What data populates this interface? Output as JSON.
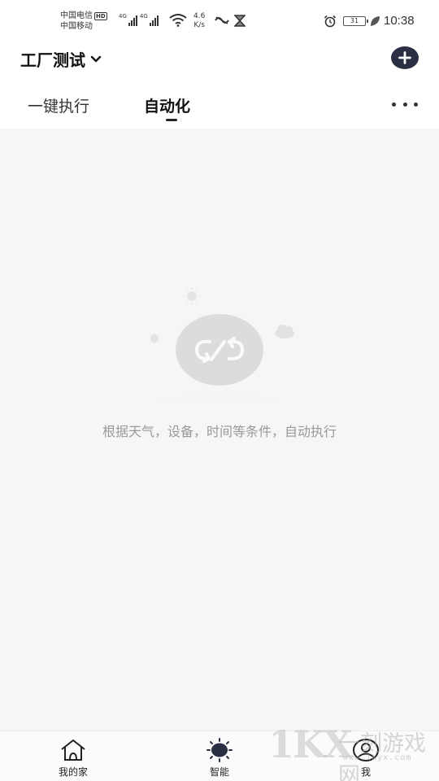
{
  "status_bar": {
    "carrier_1": "中国电信",
    "carrier_1_badge": "HD",
    "carrier_2": "中国移动",
    "signal_1_tag": "4G",
    "signal_2_tag": "4G",
    "net_speed_value": "4.6",
    "net_speed_unit": "K/s",
    "battery_level": "31",
    "time": "10:38"
  },
  "header": {
    "home_name": "工厂测试",
    "selector_icon": "chevron-down-icon",
    "add_icon": "plus-icon",
    "add_button_color": "#2b2f44"
  },
  "tabs": [
    {
      "label": "一键执行",
      "active": false
    },
    {
      "label": "自动化",
      "active": true
    }
  ],
  "more_icon": "more-horizontal-icon",
  "empty_state": {
    "icon": "automation-loop-icon",
    "message": "根据天气，设备，时间等条件，自动执行"
  },
  "bottom_nav": [
    {
      "label": "我的家",
      "icon": "home-icon",
      "active": false
    },
    {
      "label": "智能",
      "icon": "smart-sun-icon",
      "active": true
    },
    {
      "label": "我",
      "icon": "profile-icon",
      "active": false
    }
  ],
  "watermark": {
    "logo": "1KX",
    "text": "一刻游戏网",
    "domain": "www.1kyx.com"
  },
  "colors": {
    "content_background": "#f6f6f6",
    "active_text": "#111111",
    "muted_text": "#999999"
  }
}
